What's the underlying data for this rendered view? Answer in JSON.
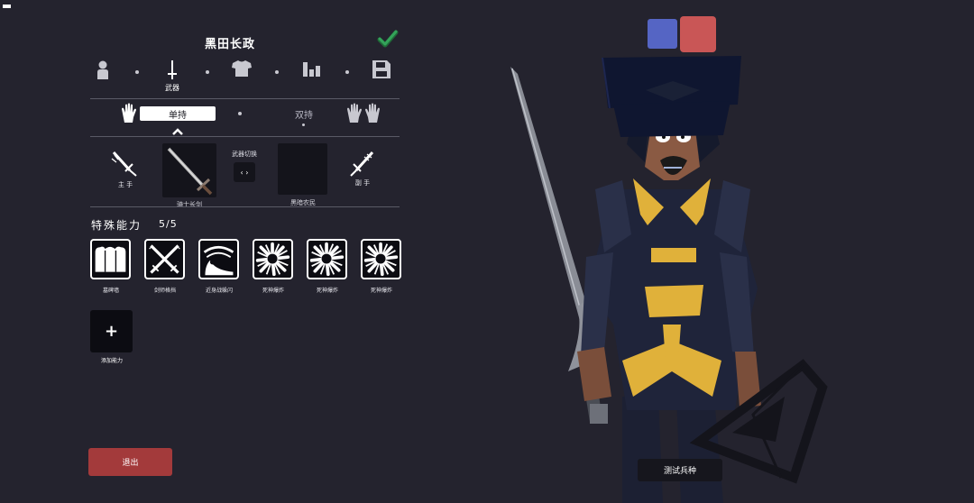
{
  "unit": {
    "name": "黑田长政"
  },
  "tabs": [
    {
      "icon": "person-icon",
      "label": ""
    },
    {
      "icon": "sword-icon",
      "label": "武器"
    },
    {
      "icon": "shirt-icon",
      "label": ""
    },
    {
      "icon": "stats-icon",
      "label": ""
    },
    {
      "icon": "save-icon",
      "label": ""
    }
  ],
  "grip": {
    "single": "单持",
    "dual": "双持"
  },
  "weapons": {
    "main_hand_label": "主 手",
    "off_hand_label": "副 手",
    "main_weapon_name": "骑士长剑",
    "switch_label": "武器切换",
    "switch_glyph": "‹ ›",
    "off_weapon_name": "黑暗农民"
  },
  "abilities": {
    "title": "特殊能力",
    "count": "5/5",
    "items": [
      {
        "name": "墓碑墙",
        "icon": "tombstone-wall-icon"
      },
      {
        "name": "剑师格挡",
        "icon": "crossed-swords-icon"
      },
      {
        "name": "近身战躲闪",
        "icon": "dodge-icon"
      },
      {
        "name": "死神爆炸",
        "icon": "explosion-icon"
      },
      {
        "name": "死神爆炸",
        "icon": "explosion-icon"
      },
      {
        "name": "死神爆炸",
        "icon": "explosion-icon"
      }
    ],
    "add_symbol": "+",
    "add_label": "添加能力"
  },
  "actions": {
    "quit": "退出",
    "test_unit": "测试兵种"
  },
  "colors": {
    "background": "#24232e",
    "quit_button": "#a33a3b",
    "team_blue": "#5565c4",
    "team_red": "#c95656",
    "check_green": "#2e8b4a"
  }
}
